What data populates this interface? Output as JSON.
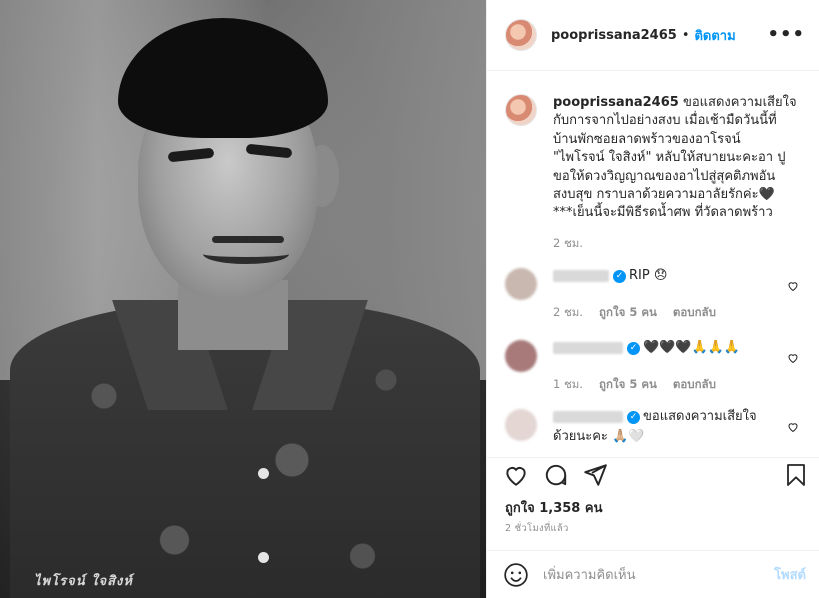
{
  "post": {
    "username": "pooprissana2465",
    "follow_label": "ติดตาม",
    "separator": "•",
    "more_label": "•••",
    "photo_caption": "ไพโรจน์ ใจสิงห์",
    "caption_lines": [
      "ขอแสดงความเสียใจ",
      "กับการจากไปอย่างสงบ เมื่อเช้ามืดวันนี้ที่",
      "บ้านพักซอยลาดพร้าวของอาโรจน์",
      "\"ไพโรจน์ ใจสิงห์\" หลับให้สบายนะคะอา ปู",
      "ขอให้ดวงวิญญาณของอาไปสู่สุคติภพอัน",
      "สงบสุข กราบลาด้วยความอาลัยรักค่ะ🖤",
      "***เย็นนี้จะมีพิธีรดน้ำศพ ที่วัดลาดพร้าว"
    ],
    "caption_time": "2 ชม.",
    "likes": "ถูกใจ 1,358 คน",
    "post_time": "2 ชั่วโมงที่แล้ว",
    "add_comment_placeholder": "เพิ่มความคิดเห็น",
    "post_button": "โพสต์"
  },
  "comments": [
    {
      "text": "RIP 😞",
      "time": "2 ชม.",
      "likes": "ถูกใจ 5 คน",
      "reply": "ตอบกลับ",
      "avatar_color": "#c9b8b0"
    },
    {
      "text": "🖤🖤🖤🙏🙏🙏",
      "time": "1 ชม.",
      "likes": "ถูกใจ 5 คน",
      "reply": "ตอบกลับ",
      "avatar_color": "#a87a7a"
    },
    {
      "text_line1": "ขอแสดงความเสียใจ",
      "text_line2": "ด้วยนะคะ 🙏🏼🤍",
      "avatar_color": "#e3d6d3"
    }
  ],
  "colors": {
    "accent": "#0095f6",
    "muted": "#8e8e8e",
    "text": "#262626",
    "border": "#efefef"
  },
  "icons": [
    "heart-icon",
    "comment-icon",
    "share-icon",
    "bookmark-icon",
    "emoji-icon",
    "more-icon",
    "verified-icon"
  ]
}
